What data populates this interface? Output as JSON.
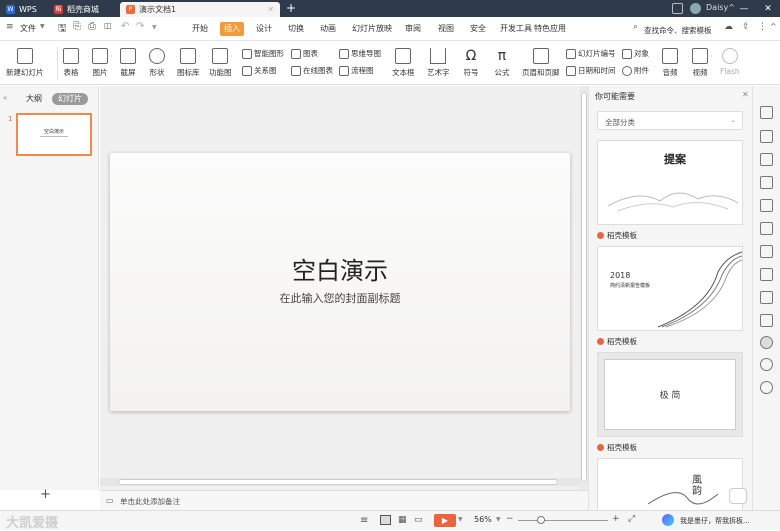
{
  "titlebar": {
    "tabs": [
      {
        "label": "WPS",
        "color": "#2d6ad6"
      },
      {
        "label": "稻壳商城",
        "color": "#d7393c"
      },
      {
        "label": "演示文档1",
        "color": "#ee6a3a"
      }
    ],
    "user": "Daisy^"
  },
  "menubar": {
    "file": "文件",
    "items": [
      "开始",
      "插入",
      "设计",
      "切换",
      "动画",
      "幻灯片放映",
      "审阅",
      "视图",
      "安全",
      "开发工具",
      "特色应用"
    ],
    "active_index": 1,
    "search": "查找命令、搜索模板"
  },
  "ribbon": {
    "new_slide": "新建幻灯片",
    "table": "表格",
    "picture": "图片",
    "screenshot": "截屏",
    "shapes": "形状",
    "icon_lib": "图标库",
    "functions": "功能图",
    "smartart": "智能图形",
    "chart": "图表",
    "mindmap": "思维导图",
    "relation": "关系图",
    "online_chart": "在线图表",
    "flowchart": "流程图",
    "textbox": "文本框",
    "wordart": "艺术字",
    "symbol": "符号",
    "formula": "公式",
    "header_footer": "页眉和页脚",
    "slide_number": "幻灯片编号",
    "datetime": "日期和时间",
    "object": "对象",
    "attachment": "附件",
    "audio": "音频",
    "video": "视频",
    "flash": "Flash"
  },
  "left_panel": {
    "outline": "大纲",
    "slides": "幻灯片",
    "slide_no": "1",
    "thumb_title": "空白演示"
  },
  "slide": {
    "title": "空白演示",
    "subtitle": "在此输入您的封面副标题"
  },
  "notes": "单击此处添加备注",
  "right_panel": {
    "header": "你可能需要",
    "filter": "全部分类",
    "templates": [
      {
        "source": "稻壳模板",
        "text": "提案"
      },
      {
        "source": "稻壳模板",
        "year": "2018",
        "text": "简约清新报告模板"
      },
      {
        "source": "稻壳模板",
        "text": "极 简"
      },
      {
        "source": "",
        "text": "風 韵"
      }
    ]
  },
  "status": {
    "zoom": "56%",
    "assistant": "我是墨仔，帮我拆板...",
    "watermark": "大凯爱摄"
  }
}
